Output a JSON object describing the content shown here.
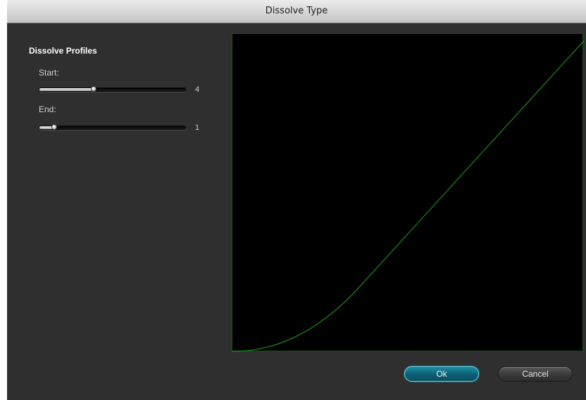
{
  "window": {
    "title": "Dissolve Type"
  },
  "dissolve_profiles": {
    "section_title": "Dissolve Profiles",
    "start": {
      "label": "Start:",
      "value": "4",
      "level": 0.37
    },
    "end": {
      "label": "End:",
      "value": "1",
      "level": 0.1
    }
  },
  "graph": {
    "curve_color": "#1fa51f",
    "background": "#000000"
  },
  "buttons": {
    "ok_label": "Ok",
    "cancel_label": "Cancel"
  },
  "colors": {
    "accent": "#1f8fa6",
    "panel": "#2f2f2f"
  }
}
